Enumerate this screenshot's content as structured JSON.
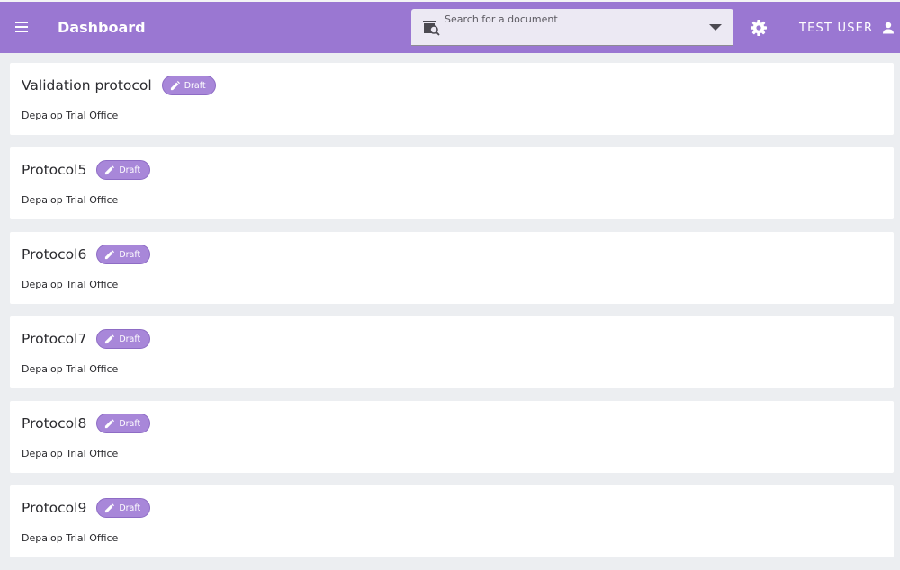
{
  "header": {
    "title": "Dashboard",
    "search_label": "Search for a document",
    "search_value": "",
    "user_label": "TEST USER",
    "menu_icon": "hamburger-menu-icon",
    "settings_icon": "gear-icon",
    "user_icon": "person-icon",
    "accent_color": "#9a77d2"
  },
  "documents": [
    {
      "title": "Validation protocol",
      "status": "Draft",
      "office": "Depalop Trial Office"
    },
    {
      "title": "Protocol5",
      "status": "Draft",
      "office": "Depalop Trial Office"
    },
    {
      "title": "Protocol6",
      "status": "Draft",
      "office": "Depalop Trial Office"
    },
    {
      "title": "Protocol7",
      "status": "Draft",
      "office": "Depalop Trial Office"
    },
    {
      "title": "Protocol8",
      "status": "Draft",
      "office": "Depalop Trial Office"
    },
    {
      "title": "Protocol9",
      "status": "Draft",
      "office": "Depalop Trial Office"
    }
  ]
}
